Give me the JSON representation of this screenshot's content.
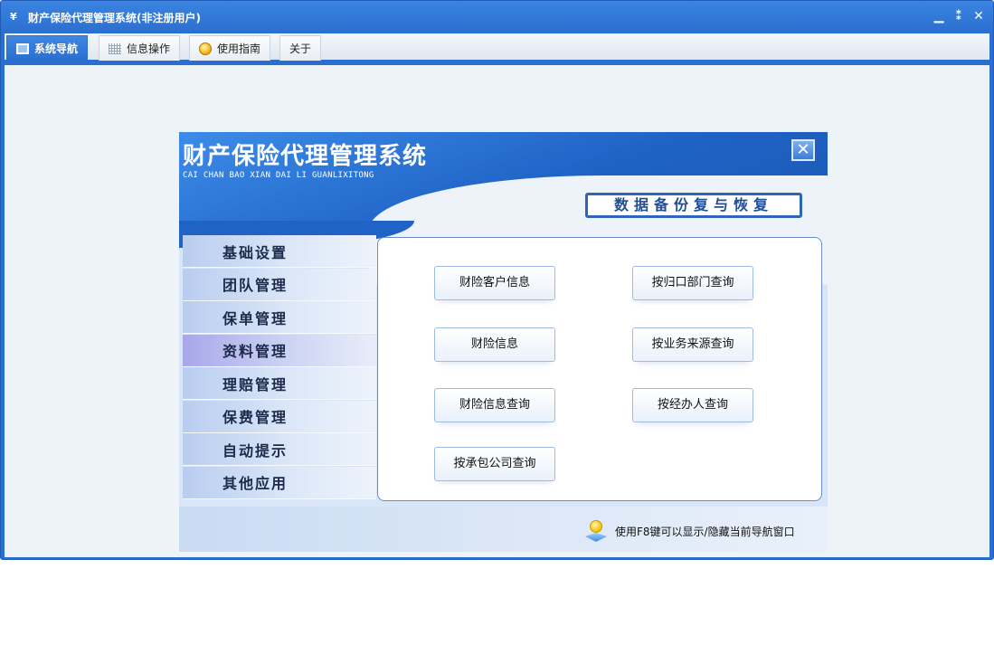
{
  "window": {
    "title": "财产保险代理管理系统(非注册用户)",
    "app_icon_glyph": "¥",
    "controls": {
      "minimize": "▁",
      "restore": "⁑",
      "close": "✕"
    },
    "accent_color": "#2a6fd0"
  },
  "tabs": [
    {
      "label": "系统导航",
      "icon": "monitor-icon",
      "active": true
    },
    {
      "label": "信息操作",
      "icon": "grid-icon",
      "active": false
    },
    {
      "label": "使用指南",
      "icon": "bulb-icon",
      "active": false
    },
    {
      "label": "关于",
      "icon": null,
      "active": false
    }
  ],
  "dialog": {
    "title": "财产保险代理管理系统",
    "subtitle": "CAI CHAN BAO XIAN DAI LI GUANLIXITONG",
    "close_glyph": "✕",
    "section_title": "数据备份复与恢复",
    "menu": [
      {
        "label": "基础设置",
        "active": false
      },
      {
        "label": "团队管理",
        "active": false
      },
      {
        "label": "保单管理",
        "active": false
      },
      {
        "label": "资料管理",
        "active": true
      },
      {
        "label": "理赔管理",
        "active": false
      },
      {
        "label": "保费管理",
        "active": false
      },
      {
        "label": "自动提示",
        "active": false
      },
      {
        "label": "其他应用",
        "active": false
      }
    ],
    "actions": [
      "财险客户信息",
      "按归口部门查询",
      "财险信息",
      "按业务来源查询",
      "财险信息查询",
      "按经办人查询",
      "按承包公司查询"
    ],
    "footer_tip": "使用F8键可以显示/隐藏当前导航窗口"
  }
}
